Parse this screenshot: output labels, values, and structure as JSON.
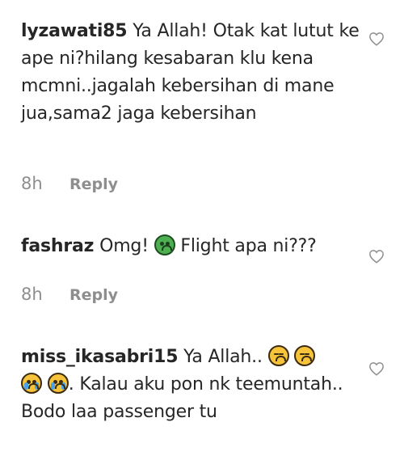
{
  "comments": [
    {
      "username": "lyzawati85",
      "text": "Ya Allah! Otak kat lutut ke ape ni?hilang kesabaran klu kena mcmni..jagalah kebersihan di mane jua,sama2 jaga kebersihan",
      "time": "8h",
      "reply_label": "Reply",
      "like_icon": "heart-outline-icon"
    },
    {
      "username": "fashraz",
      "text_before": "Omg!",
      "emoji": "nauseated-face-emoji",
      "text_after": "Flight apa ni???",
      "time": "8h",
      "reply_label": "Reply",
      "like_icon": "heart-outline-icon"
    },
    {
      "username": "miss_ikasabri15",
      "text_before": "Ya Allah..",
      "emojis": [
        "tired-face-emoji",
        "tired-face-emoji",
        "loudly-crying-face-emoji",
        "loudly-crying-face-emoji"
      ],
      "text_after": ". Kalau aku pon nk teemuntah.. Bodo laa passenger tu",
      "like_icon": "heart-outline-icon"
    }
  ],
  "colors": {
    "text": "#262626",
    "secondary": "#8e8e8e",
    "background": "#ffffff"
  }
}
